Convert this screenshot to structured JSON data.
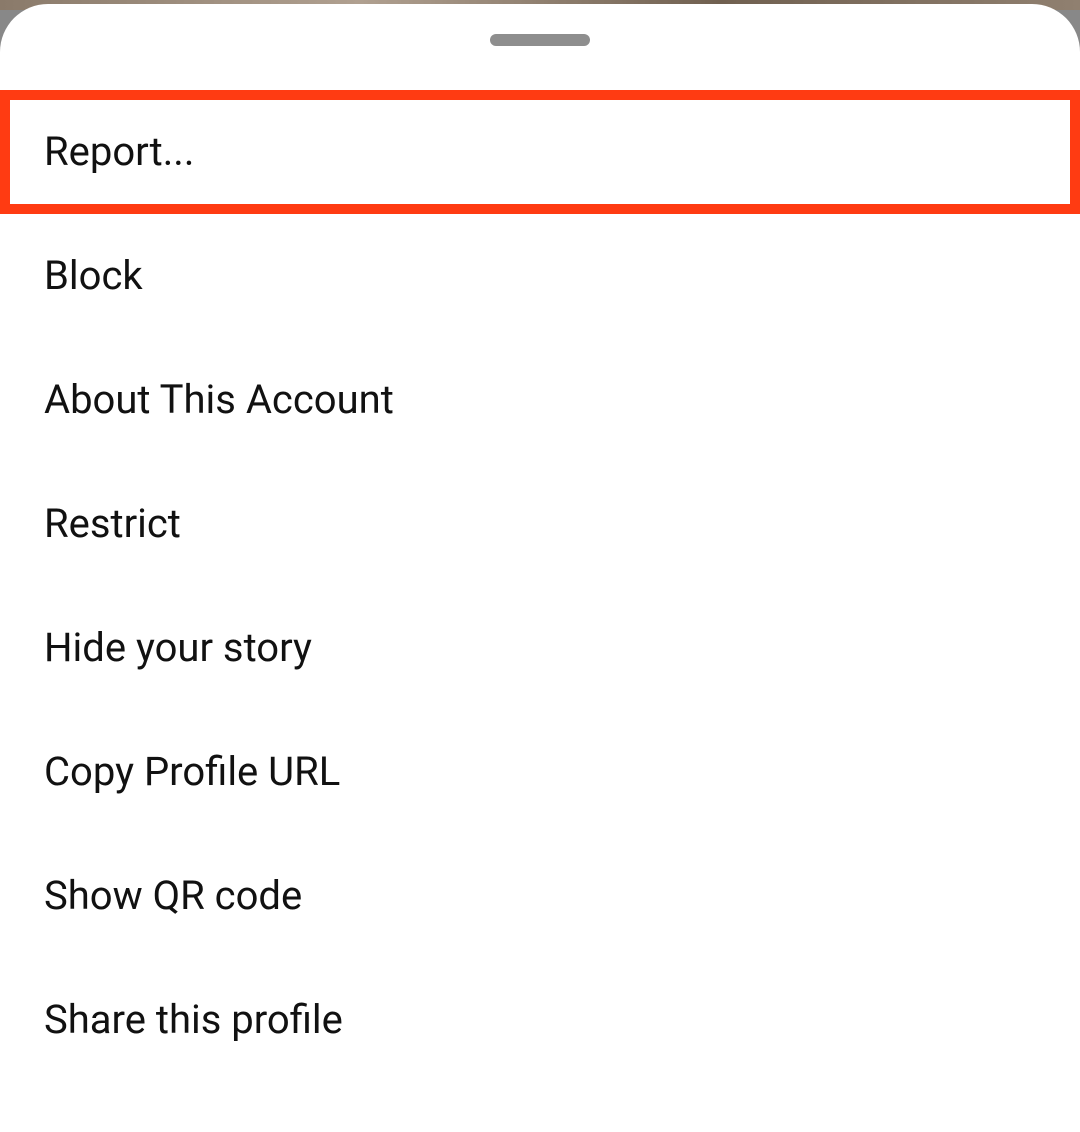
{
  "menu": {
    "items": [
      {
        "label": "Report...",
        "highlighted": true
      },
      {
        "label": "Block",
        "highlighted": false
      },
      {
        "label": "About This Account",
        "highlighted": false
      },
      {
        "label": "Restrict",
        "highlighted": false
      },
      {
        "label": "Hide your story",
        "highlighted": false
      },
      {
        "label": "Copy Profile URL",
        "highlighted": false
      },
      {
        "label": "Show QR code",
        "highlighted": false
      },
      {
        "label": "Share this profile",
        "highlighted": false
      }
    ]
  }
}
